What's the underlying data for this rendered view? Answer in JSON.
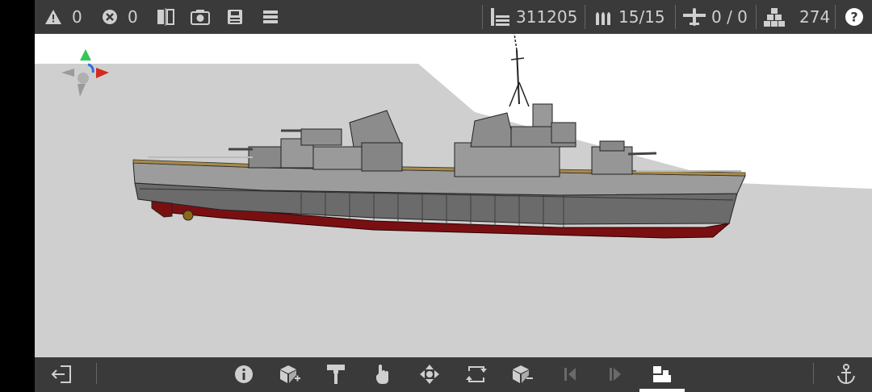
{
  "topbar": {
    "warnings": "0",
    "errors": "0",
    "stats": {
      "mass": "311205",
      "ammo": "15/15",
      "aircraft": "0 / 0",
      "parts": "274"
    },
    "icons": [
      "warning-icon",
      "error-icon",
      "mirror-icon",
      "camera-icon",
      "save-icon",
      "menu-icon",
      "mass-icon",
      "ammo-icon",
      "aircraft-icon",
      "parts-icon",
      "help-icon"
    ]
  },
  "bottombar": {
    "icons": [
      "exit-icon",
      "info-icon",
      "add-block-icon",
      "paint-icon",
      "hand-icon",
      "move-icon",
      "rotate-icon",
      "remove-block-icon",
      "prev-icon",
      "next-icon",
      "build-icon",
      "anchor-icon"
    ],
    "active": "build-icon"
  },
  "colors": {
    "bar": "#3a3a3a",
    "viewport": "#cfcfcf",
    "hull_red": "#7a0f12",
    "hull_gray": "#6a6a6a",
    "deck": "#a88a4a",
    "axis_green": "#34c759",
    "axis_red": "#d42a1e",
    "axis_blue": "#2b6fe0"
  }
}
